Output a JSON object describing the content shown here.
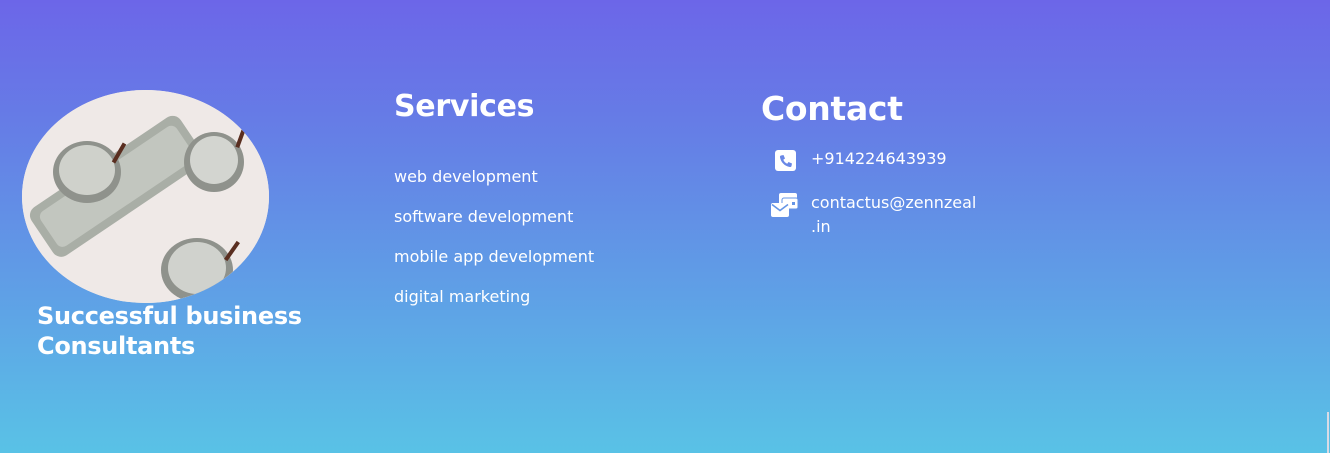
{
  "brand": {
    "tagline_line1": "Successful business",
    "tagline_line2": "Consultants"
  },
  "services": {
    "heading": "Services",
    "items": [
      "web development",
      "software development",
      "mobile app development",
      "digital marketing"
    ]
  },
  "contact": {
    "heading": "Contact",
    "phone": "+914224643939",
    "email_line1": "contactus@zennzeal",
    "email_line2": ".in"
  },
  "colors": {
    "gradient_top": "#6c66e8",
    "gradient_bottom": "#59c2e6",
    "text": "#ffffff"
  },
  "icons": {
    "phone": "phone-square-icon",
    "email": "envelope-stack-icon"
  }
}
